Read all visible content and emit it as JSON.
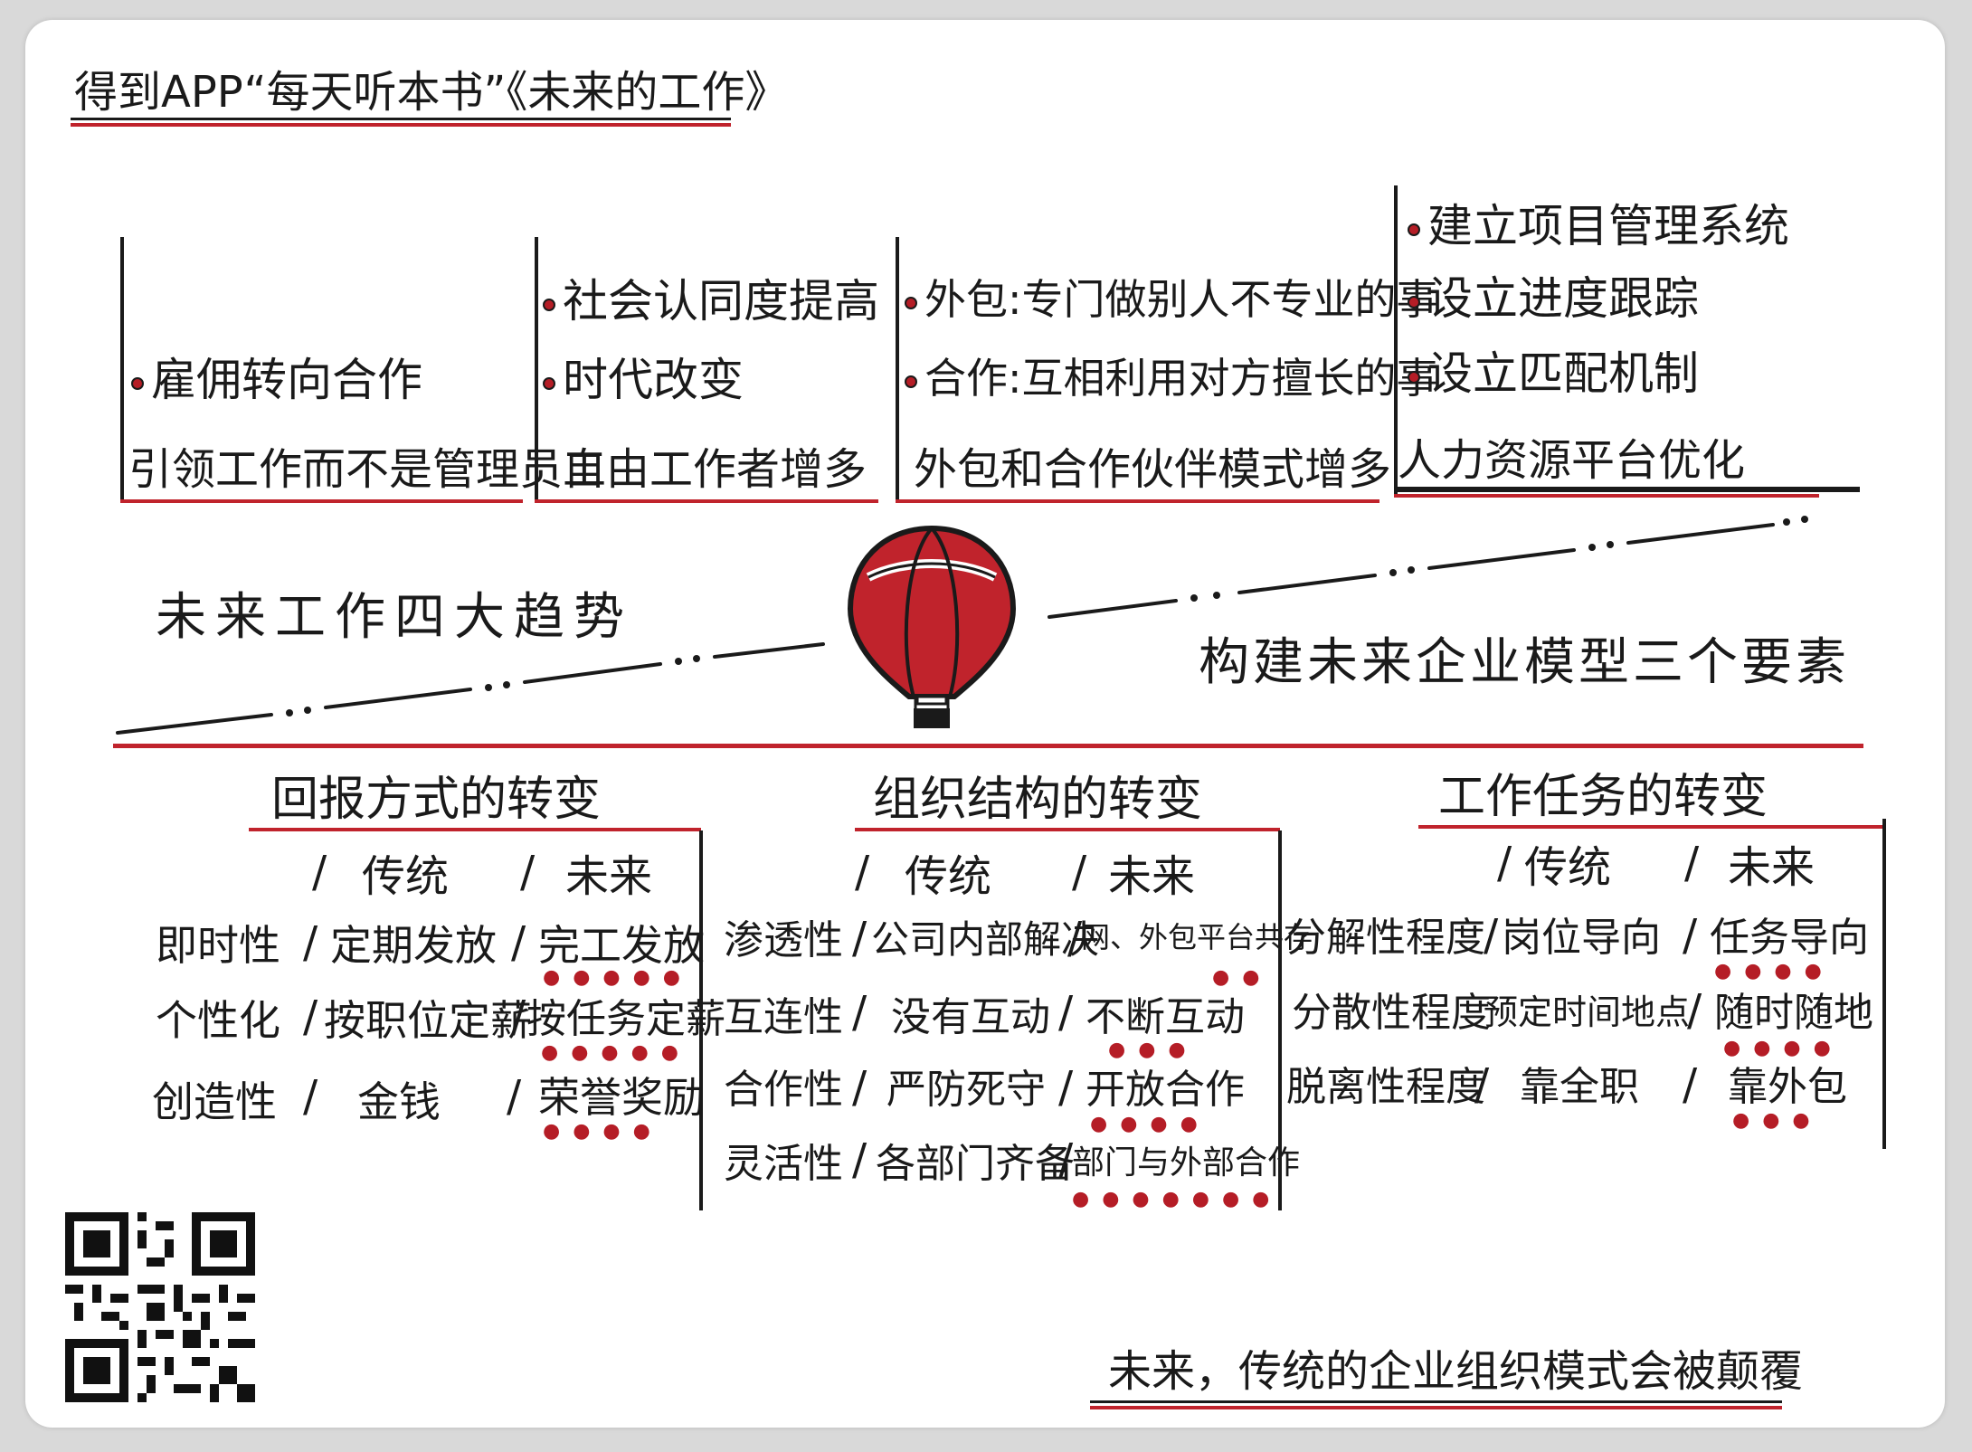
{
  "header": {
    "title": "得到APP“每天听本书”《未来的工作》"
  },
  "trends": [
    {
      "bullets": [
        "雇佣转向合作"
      ],
      "summary": "引领工作而不是管理员工"
    },
    {
      "bullets": [
        "社会认同度提高",
        "时代改变"
      ],
      "summary": "自由工作者增多"
    },
    {
      "bullets": [
        "外包:专门做别人不专业的事",
        "合作:互相利用对方擅长的事"
      ],
      "summary": "外包和合作伙伴模式增多"
    },
    {
      "bullets": [
        "建立项目管理系统",
        "设立进度跟踪",
        "设立匹配机制"
      ],
      "summary": "人力资源平台优化"
    }
  ],
  "center": {
    "left_title": "未来工作四大趋势",
    "right_title": "构建未来企业模型三个要素",
    "balloon_icon": "hot-air-balloon-icon"
  },
  "tables": [
    {
      "title": "回报方式的转变",
      "col_traditional": "传统",
      "col_future": "未来",
      "rows": [
        {
          "label": "即时性",
          "traditional": "定期发放",
          "future": "完工发放"
        },
        {
          "label": "个性化",
          "traditional": "按职位定薪",
          "future": "按任务定薪"
        },
        {
          "label": "创造性",
          "traditional": "金钱",
          "future": "荣誉奖励"
        }
      ]
    },
    {
      "title": "组织结构的转变",
      "col_traditional": "传统",
      "col_future": "未来",
      "rows": [
        {
          "label": "渗透性",
          "traditional": "公司内部解决",
          "future": "网、外包平台共存"
        },
        {
          "label": "互连性",
          "traditional": "没有互动",
          "future": "不断互动"
        },
        {
          "label": "合作性",
          "traditional": "严防死守",
          "future": "开放合作"
        },
        {
          "label": "灵活性",
          "traditional": "各部门齐备",
          "future": "部门与外部合作"
        }
      ]
    },
    {
      "title": "工作任务的转变",
      "col_traditional": "传统",
      "col_future": "未来",
      "rows": [
        {
          "label": "分解性程度",
          "traditional": "岗位导向",
          "future": "任务导向"
        },
        {
          "label": "分散性程度",
          "traditional": "预定时间地点",
          "future": "随时随地"
        },
        {
          "label": "脱离性程度",
          "traditional": "靠全职",
          "future": "靠外包"
        }
      ]
    }
  ],
  "footer": {
    "conclusion": "未来，传统的企业组织模式会被颠覆",
    "qr_icon": "qr-code-icon"
  },
  "colors": {
    "accent": "#c0232c",
    "ink": "#1a1a1a",
    "paper": "#ffffff"
  }
}
